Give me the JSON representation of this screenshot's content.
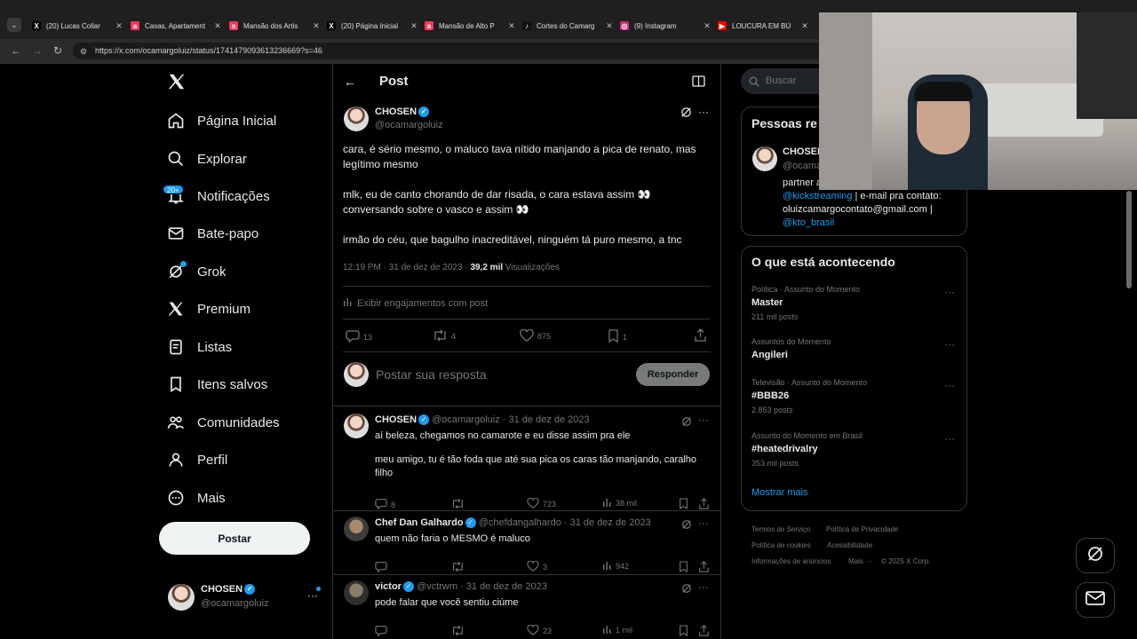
{
  "browser": {
    "tabs": [
      {
        "title": "(20) Lucas Collar",
        "fav": "X",
        "favColor": "#000"
      },
      {
        "title": "Casas, Apartament",
        "fav": "a",
        "favColor": "#ff385c"
      },
      {
        "title": "Mansão dos Artis",
        "fav": "a",
        "favColor": "#ff385c"
      },
      {
        "title": "(20) Página Inicial",
        "fav": "X",
        "favColor": "#000"
      },
      {
        "title": "Mansão de Alto P",
        "fav": "a",
        "favColor": "#ff385c"
      },
      {
        "title": "Cortes do Camarg",
        "fav": "♪",
        "favColor": "#111"
      },
      {
        "title": "(9) Instagram",
        "fav": "◎",
        "favColor": "#d62976"
      },
      {
        "title": "LOUCURA EM BÚ",
        "fav": "▶",
        "favColor": "#ff0000"
      }
    ],
    "url": "https://x.com/ocamargoluiz/status/1741479093613236669?s=46"
  },
  "sidebar": {
    "items": [
      {
        "label": "Página Inicial",
        "icon": "home-icon"
      },
      {
        "label": "Explorar",
        "icon": "search-icon"
      },
      {
        "label": "Notificações",
        "icon": "bell-icon"
      },
      {
        "label": "Bate-papo",
        "icon": "mail-icon"
      },
      {
        "label": "Grok",
        "icon": "grok-icon"
      },
      {
        "label": "Premium",
        "icon": "x-logo-icon"
      },
      {
        "label": "Listas",
        "icon": "list-icon"
      },
      {
        "label": "Itens salvos",
        "icon": "bookmark-icon"
      },
      {
        "label": "Comunidades",
        "icon": "people-icon"
      },
      {
        "label": "Perfil",
        "icon": "person-icon"
      },
      {
        "label": "Mais",
        "icon": "more-circle-icon"
      }
    ],
    "notif_badge": "20+",
    "post_button": "Postar",
    "account": {
      "name": "CHOSEN",
      "handle": "@ocamargoluiz"
    }
  },
  "header": {
    "title": "Post"
  },
  "post": {
    "author": "CHOSEN",
    "handle": "@ocamargoluiz",
    "paragraphs": [
      "cara, é sério mesmo, o maluco tava nítido manjando a pica de renato, mas legítimo mesmo",
      "mlk, eu de canto chorando de dar risada, o cara estava assim 👀 conversando sobre o vasco e assim 👀",
      "irmão do céu, que bagulho inacreditável, ninguém tá puro mesmo, a tnc"
    ],
    "timestamp": "12:19 PM · 31 de dez de 2023 ·",
    "views": "39,2 mil",
    "views_label": "Visualizações",
    "engagements": "Exibir engajamentos com post",
    "stats": {
      "replies": "13",
      "reposts": "4",
      "likes": "875",
      "bookmarks": "1"
    }
  },
  "reply_box": {
    "placeholder": "Postar sua resposta",
    "button": "Responder"
  },
  "replies": [
    {
      "name": "CHOSEN",
      "meta": "@ocamargoluiz · 31 de dez de 2023",
      "lines": [
        "aí beleza, chegamos no camarote e eu disse assim pra ele",
        "meu amigo, tu é tão foda que até sua pica os caras tão manjando, caralho filho"
      ],
      "replies": "8",
      "reposts": "",
      "likes": "723",
      "views": "38 mil"
    },
    {
      "name": "Chef Dan Galhardo",
      "meta": "@chefdangalhardo · 31 de dez de 2023",
      "lines": [
        "quem não faria o MESMO é maluco"
      ],
      "replies": "",
      "reposts": "",
      "likes": "3",
      "views": "942"
    },
    {
      "name": "victor",
      "meta": "@vctrwm · 31 de dez de 2023",
      "lines": [
        "pode falar que você sentiu ciúme"
      ],
      "replies": "",
      "reposts": "",
      "likes": "23",
      "views": "1 mil"
    }
  ],
  "right": {
    "search_placeholder": "Buscar",
    "people_title": "Pessoas re",
    "person": {
      "name": "CHOSEN",
      "handle": "@ocama",
      "bio1": "partner a",
      "bio_link1": "@kickstreaming",
      "bio2": "| e-mail pra contato:",
      "bio3": "oluizcamargocontato@gmail.com |",
      "bio_link2": "@kto_brasil"
    },
    "trends_title": "O que está acontecendo",
    "trends": [
      {
        "cat": "Política · Assunto do Momento",
        "name": "Master",
        "count": "211 mil posts"
      },
      {
        "cat": "Assuntos do Momento",
        "name": "Angileri",
        "count": ""
      },
      {
        "cat": "Televisão · Assunto do Momento",
        "name": "#BBB26",
        "count": "2.853 posts"
      },
      {
        "cat": "Assunto do Momento em Brasil",
        "name": "#heatedrivalry",
        "count": "353 mil posts"
      }
    ],
    "show_more": "Mostrar mais",
    "footer": [
      "Termos de Serviço",
      "Política de Privacidade",
      "Política de cookies",
      "Acessibilidade",
      "Informações de anúncios",
      "Mais ···",
      "© 2025 X Corp."
    ]
  },
  "colors": {
    "accent": "#1d9bf0",
    "bg": "#000000",
    "border": "#2f3336",
    "muted": "#71767b"
  }
}
